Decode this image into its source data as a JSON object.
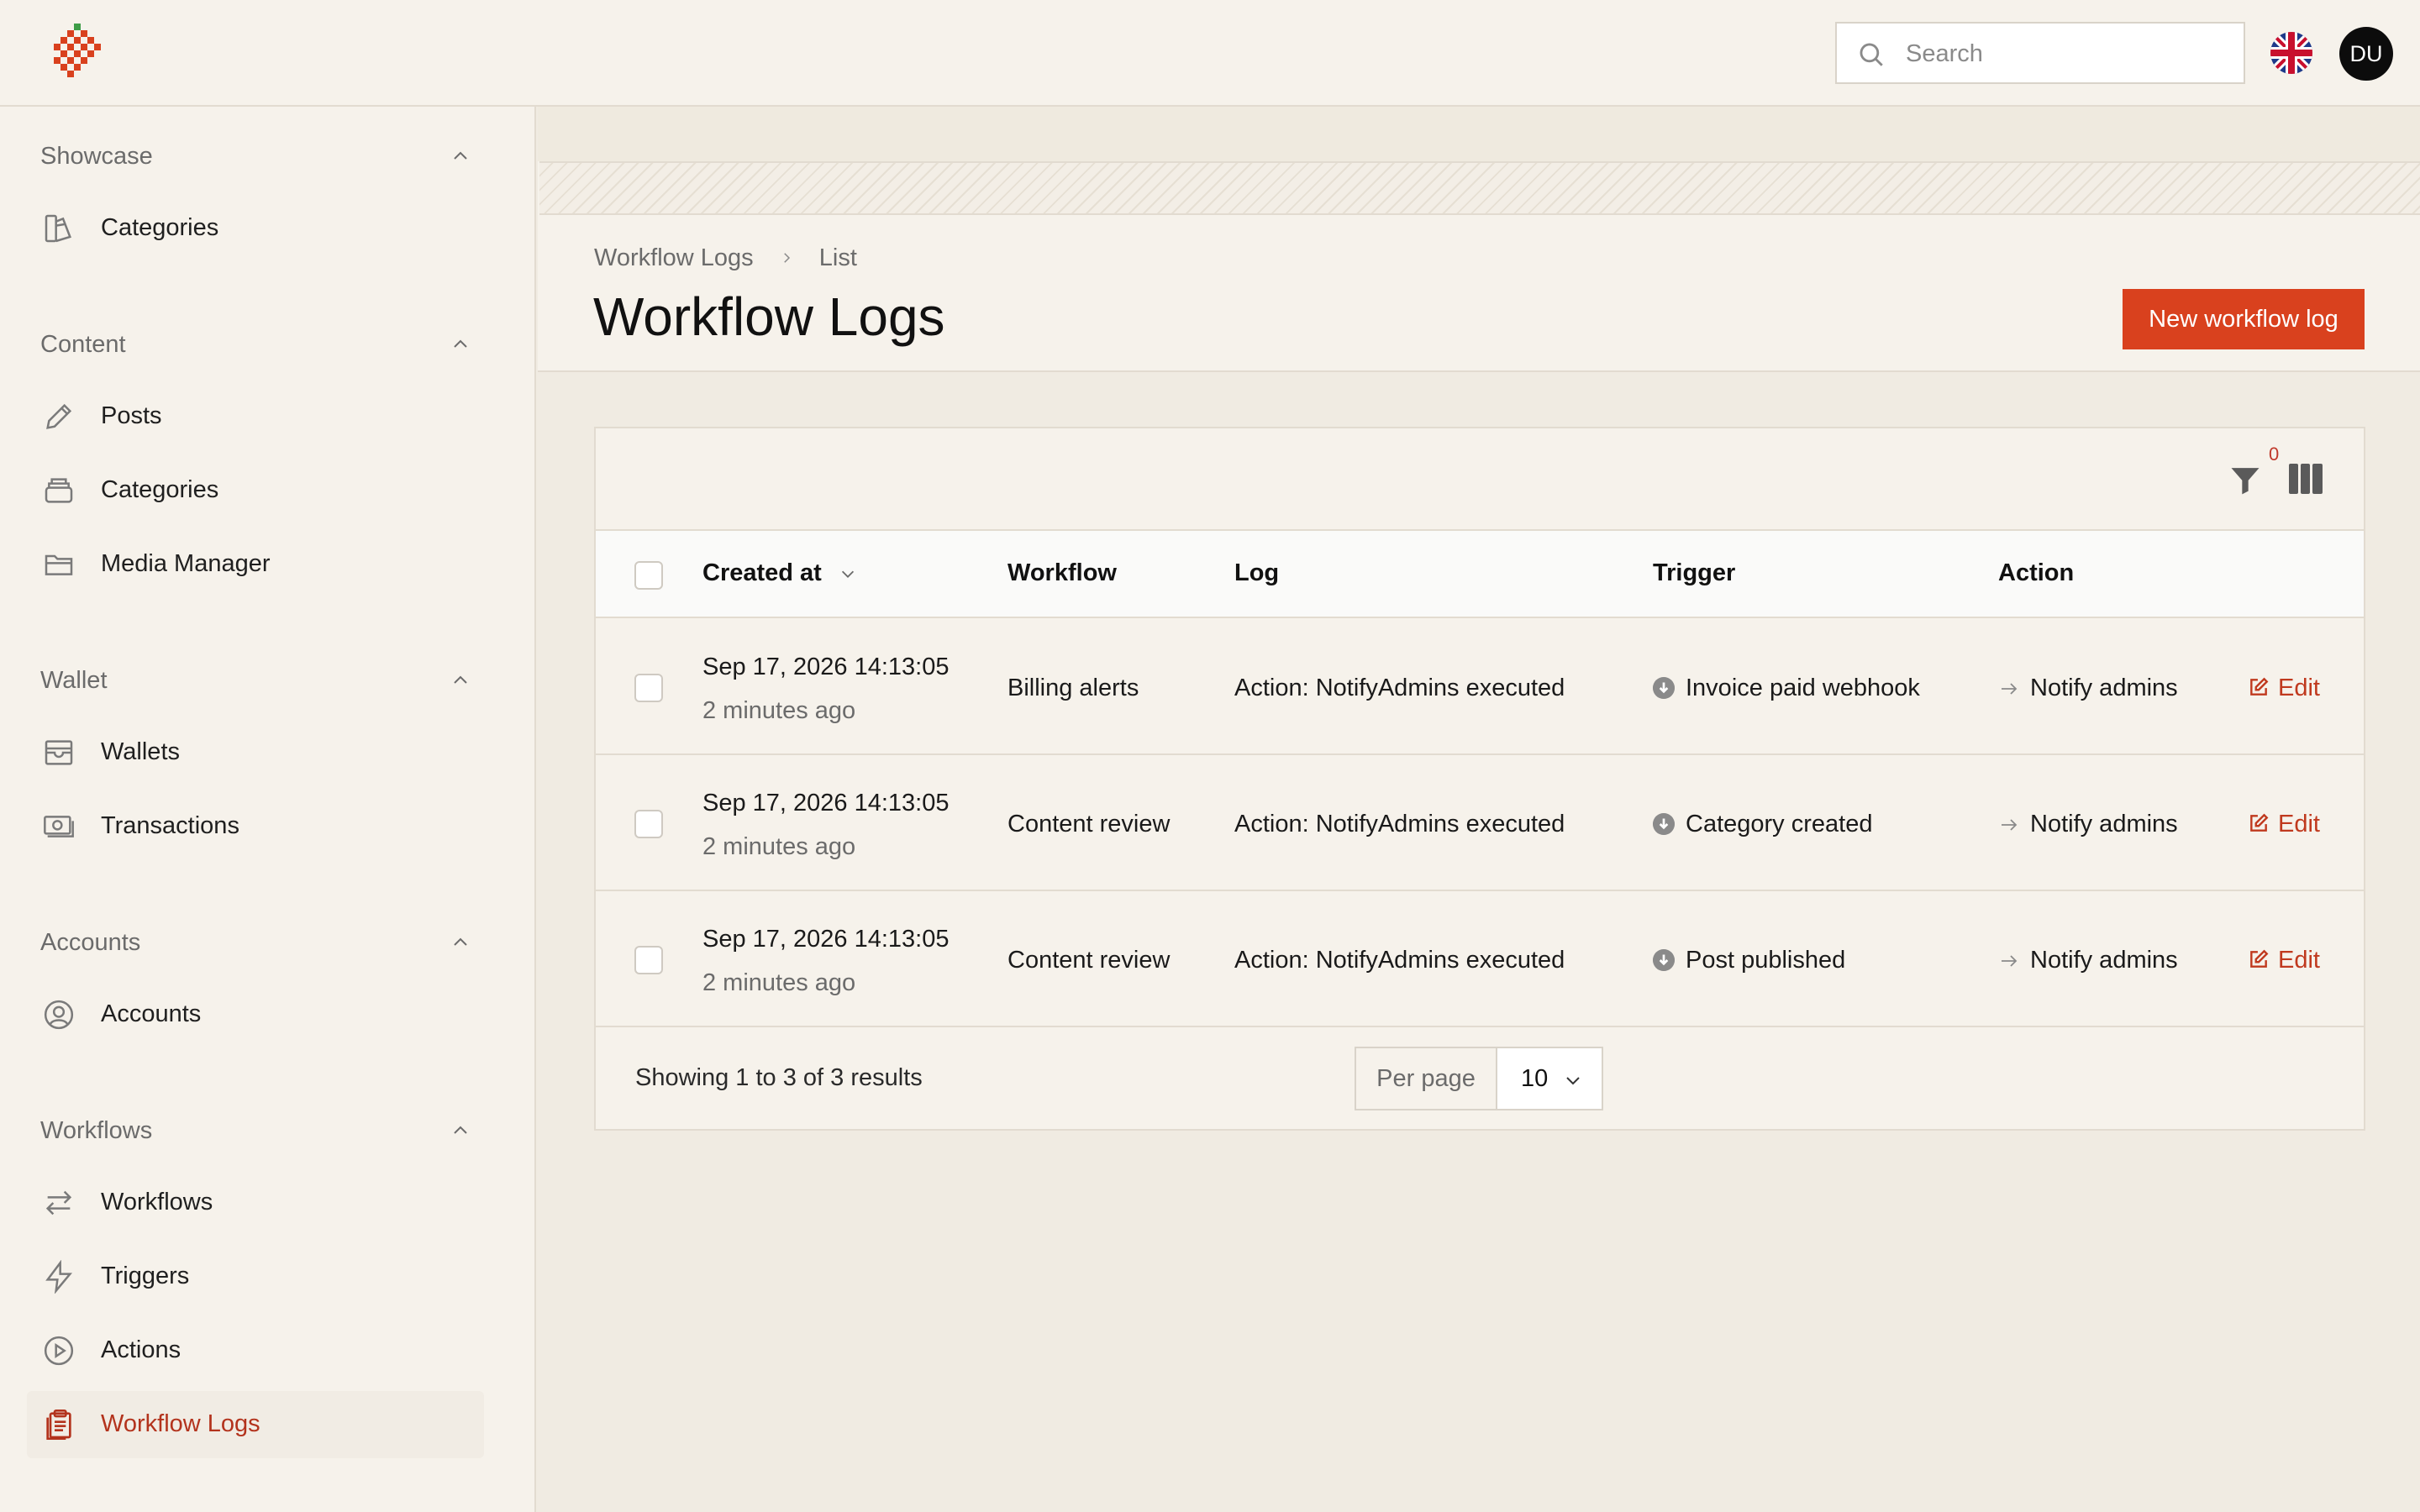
{
  "topbar": {
    "search_placeholder": "Search",
    "language_flag": "uk-flag-icon",
    "user_initials": "DU"
  },
  "sidebar": {
    "groups": [
      {
        "title": "Showcase",
        "items": [
          {
            "label": "Categories",
            "icon": "categories-showcase-icon"
          }
        ]
      },
      {
        "title": "Content",
        "items": [
          {
            "label": "Posts",
            "icon": "pencil-icon"
          },
          {
            "label": "Categories",
            "icon": "stack-icon"
          },
          {
            "label": "Media Manager",
            "icon": "folder-icon"
          }
        ]
      },
      {
        "title": "Wallet",
        "items": [
          {
            "label": "Wallets",
            "icon": "wallet-icon"
          },
          {
            "label": "Transactions",
            "icon": "cash-icon"
          }
        ]
      },
      {
        "title": "Accounts",
        "items": [
          {
            "label": "Accounts",
            "icon": "user-circle-icon"
          }
        ]
      },
      {
        "title": "Workflows",
        "items": [
          {
            "label": "Workflows",
            "icon": "arrows-icon"
          },
          {
            "label": "Triggers",
            "icon": "bolt-icon"
          },
          {
            "label": "Actions",
            "icon": "play-icon"
          },
          {
            "label": "Workflow Logs",
            "icon": "clipboard-icon",
            "active": true
          }
        ]
      }
    ]
  },
  "header": {
    "breadcrumb": [
      "Workflow Logs",
      "List"
    ],
    "title": "Workflow Logs",
    "new_button": "New workflow log"
  },
  "table": {
    "filter_count": "0",
    "columns": [
      "Created at",
      "Workflow",
      "Log",
      "Trigger",
      "Action"
    ],
    "rows": [
      {
        "created": "Sep 17, 2026 14:13:05",
        "ago": "2 minutes ago",
        "workflow": "Billing alerts",
        "log": "Action: NotifyAdmins executed",
        "trigger": "Invoice paid webhook",
        "action": "Notify admins",
        "edit": "Edit"
      },
      {
        "created": "Sep 17, 2026 14:13:05",
        "ago": "2 minutes ago",
        "workflow": "Content review",
        "log": "Action: NotifyAdmins executed",
        "trigger": "Category created",
        "action": "Notify admins",
        "edit": "Edit"
      },
      {
        "created": "Sep 17, 2026 14:13:05",
        "ago": "2 minutes ago",
        "workflow": "Content review",
        "log": "Action: NotifyAdmins executed",
        "trigger": "Post published",
        "action": "Notify admins",
        "edit": "Edit"
      }
    ],
    "footer": {
      "showing": "Showing 1 to 3 of 3 results",
      "per_page_label": "Per page",
      "per_page_value": "10"
    }
  },
  "colors": {
    "accent": "#d9411e",
    "active_text": "#b3331d",
    "background": "#f0ebe2"
  }
}
